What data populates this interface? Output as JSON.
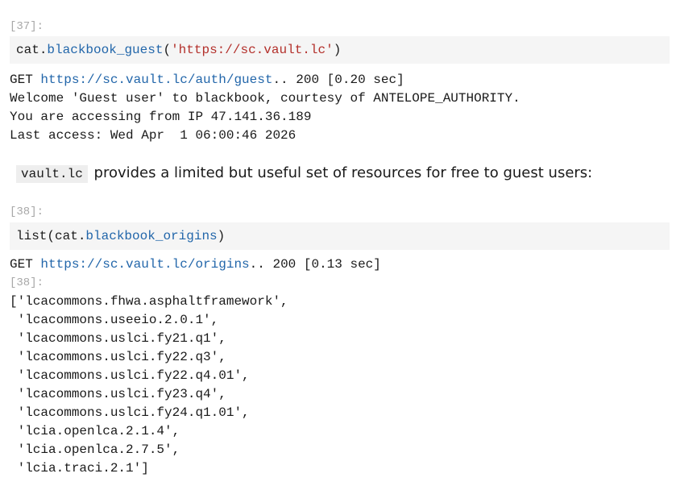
{
  "cells": [
    {
      "prompt": "[37]:",
      "input": {
        "obj": "cat",
        "dot": ".",
        "method": "blackbook_guest",
        "open": "(",
        "arg": "'https://sc.vault.lc'",
        "close": ")"
      },
      "output": {
        "get_prefix": "GET ",
        "get_url": "https://sc.vault.lc/auth/guest",
        "get_suffix": ".. 200 [0.20 sec]",
        "lines": [
          "Welcome 'Guest user' to blackbook, courtesy of ANTELOPE_AUTHORITY.",
          "You are accessing from IP 47.141.36.189",
          "Last access: Wed Apr  1 06:00:46 2026"
        ]
      }
    },
    {
      "prompt": "[38]:",
      "input": {
        "pre": "list(cat",
        "dot": ".",
        "method": "blackbook_origins",
        "close": ")"
      },
      "output": {
        "get_prefix": "GET ",
        "get_url": "https://sc.vault.lc/origins",
        "get_suffix": ".. 200 [0.13 sec]",
        "result_prompt": "[38]:",
        "lines": [
          "['lcacommons.fhwa.asphaltframework',",
          " 'lcacommons.useeio.2.0.1',",
          " 'lcacommons.uslci.fy21.q1',",
          " 'lcacommons.uslci.fy22.q3',",
          " 'lcacommons.uslci.fy22.q4.01',",
          " 'lcacommons.uslci.fy23.q4',",
          " 'lcacommons.uslci.fy24.q1.01',",
          " 'lcia.openlca.2.1.4',",
          " 'lcia.openlca.2.7.5',",
          " 'lcia.traci.2.1']"
        ]
      }
    }
  ],
  "markdown": {
    "code": "vault.lc",
    "text": " provides a limited but useful set of resources for free to guest users:"
  }
}
